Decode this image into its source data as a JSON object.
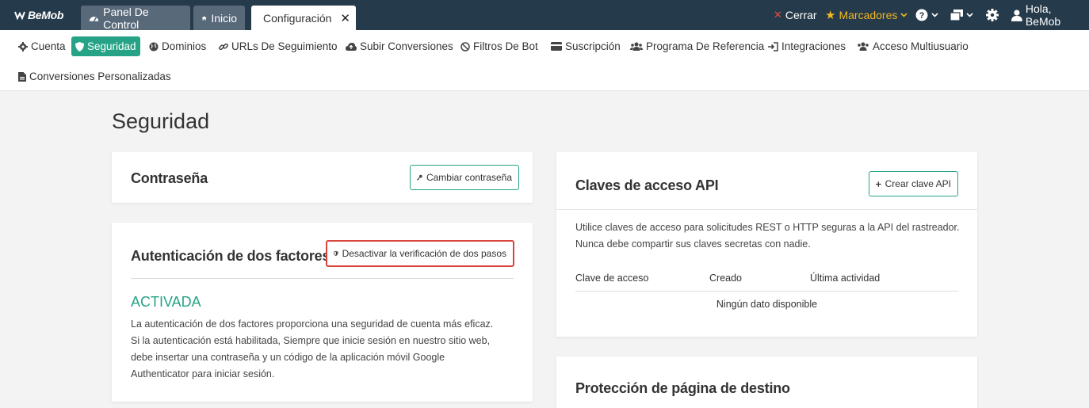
{
  "app": {
    "logo_text": "BeMob"
  },
  "tabs": [
    {
      "label": "Panel De Control"
    },
    {
      "label": "Inicio"
    },
    {
      "label": "Configuración"
    }
  ],
  "topright": {
    "close_label": "Cerrar",
    "bookmarks_label": "Marcadores",
    "greeting": "Hola, BeMob"
  },
  "subnav": {
    "items": [
      {
        "label": "Cuenta"
      },
      {
        "label": "Seguridad"
      },
      {
        "label": "Dominios"
      },
      {
        "label": "URLs De Seguimiento"
      },
      {
        "label": "Subir Conversiones"
      },
      {
        "label": "Filtros De Bot"
      },
      {
        "label": "Suscripción"
      },
      {
        "label": "Programa De Referencia"
      },
      {
        "label": "Integraciones"
      },
      {
        "label": "Acceso Multiusuario"
      },
      {
        "label": "Conversiones Personalizadas"
      }
    ]
  },
  "page": {
    "title": "Seguridad"
  },
  "password_card": {
    "title": "Contraseña",
    "button_label": "Cambiar contraseña"
  },
  "twofa_card": {
    "title": "Autenticación de dos factores",
    "button_label": "Desactivar la verificación de dos pasos",
    "status": "ACTIVADA",
    "description_lines": [
      "La autenticación de dos factores proporciona una seguridad de cuenta más eficaz.",
      "Si la autenticación está habilitada, Siempre que inicie sesión en nuestro sitio web,",
      "debe insertar una contraseña y un código de la aplicación móvil Google",
      "Authenticator para iniciar sesión."
    ]
  },
  "api_card": {
    "title": "Claves de acceso API",
    "button_label": "Crear clave API",
    "description_lines": [
      "Utilice claves de acceso para solicitudes REST o HTTP seguras a la API del rastreador.",
      "Nunca debe compartir sus claves secretas con nadie."
    ],
    "columns": [
      "Clave de acceso",
      "Creado",
      "Última actividad"
    ],
    "empty_text": "Ningún dato disponible"
  },
  "landing_card": {
    "title": "Protección de página de destino"
  },
  "colors": {
    "topbar": "#253a4a",
    "accent": "#26a386",
    "highlight_border": "#d9443a",
    "bookmarks": "#f0b823",
    "close_x": "#e74c3c"
  }
}
